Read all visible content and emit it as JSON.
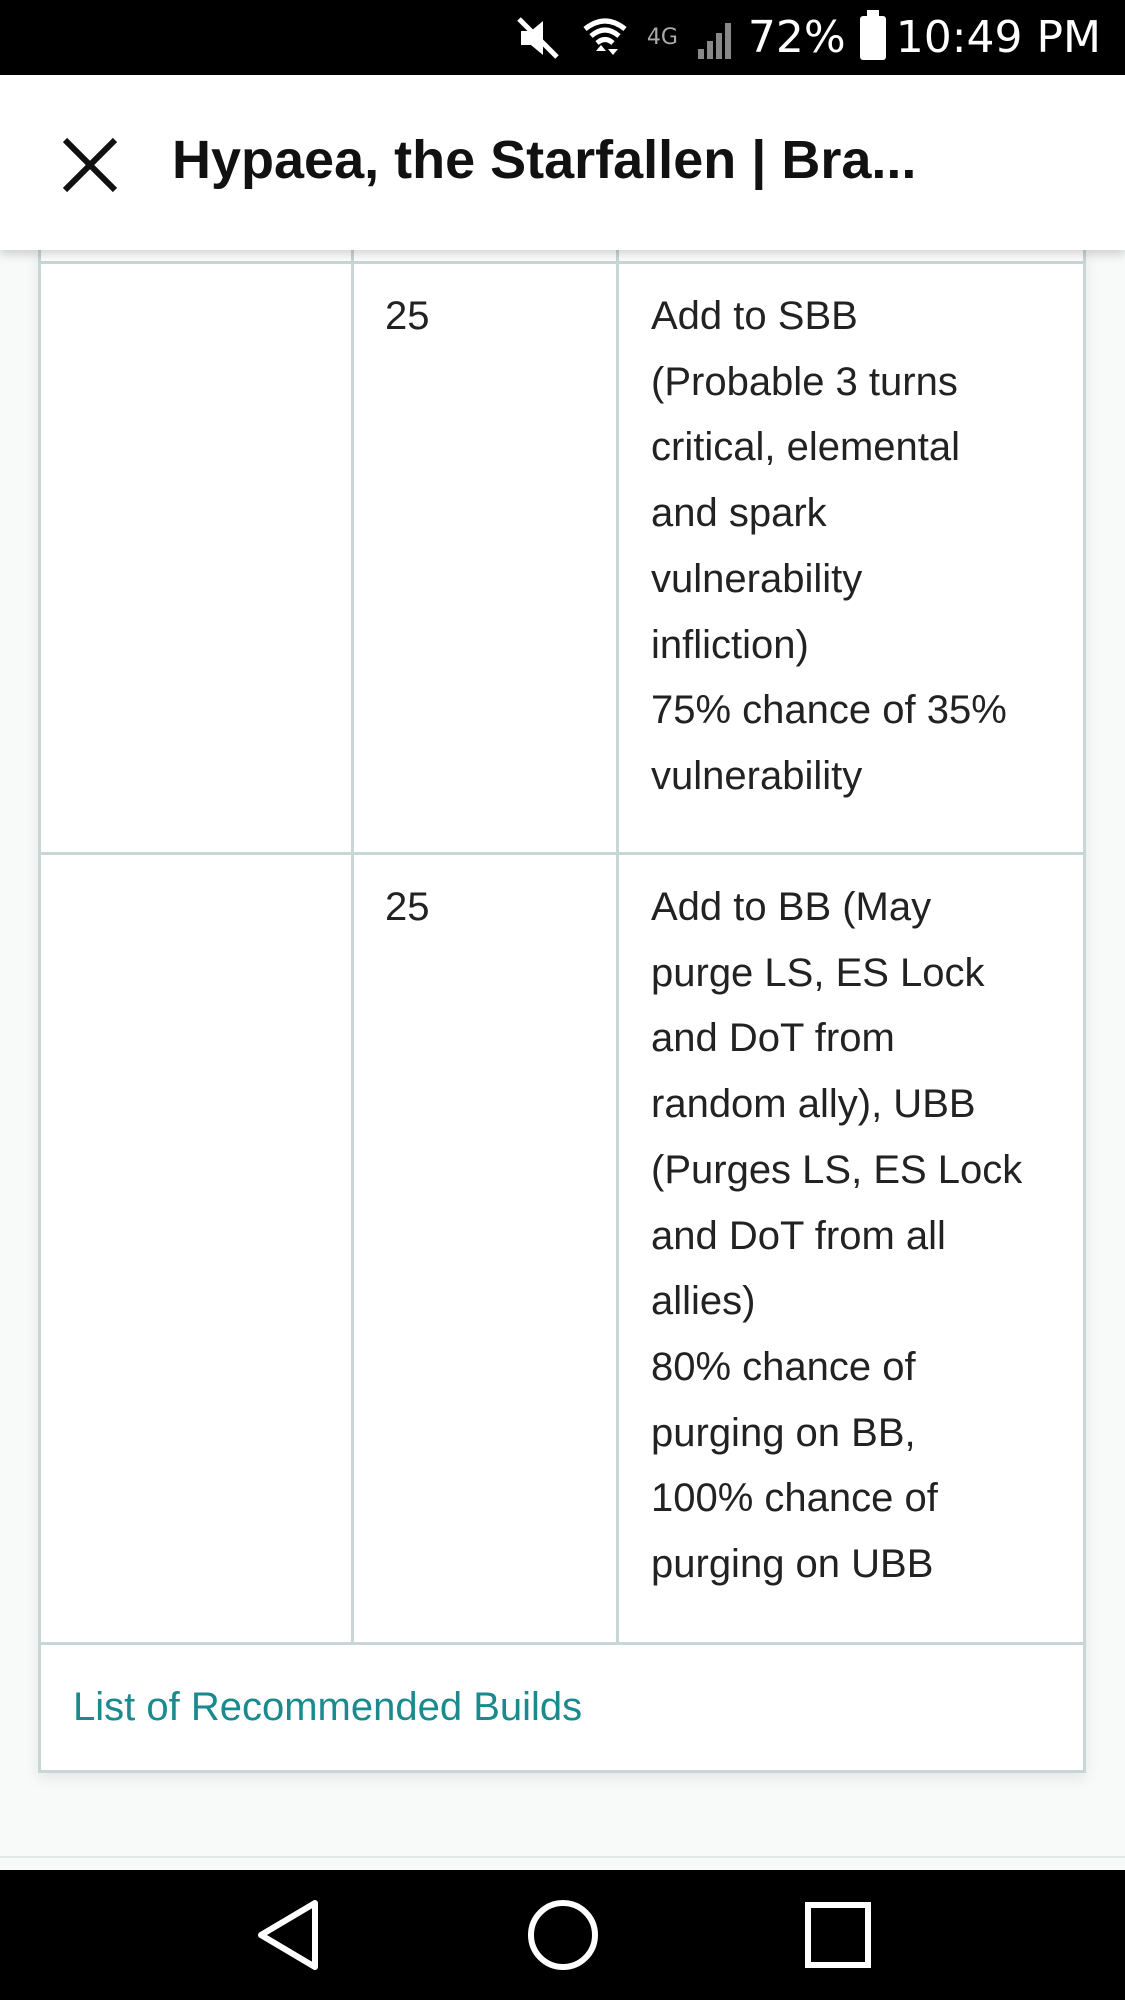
{
  "status_bar": {
    "network_label": "4G",
    "battery_percent": "72%",
    "time": "10:49 PM",
    "icons": [
      "mute-icon",
      "wifi-icon",
      "network-4g-icon",
      "signal-icon",
      "battery-icon"
    ]
  },
  "header": {
    "close_icon": "close-icon",
    "title": "Hypaea, the Starfallen | Bra..."
  },
  "table": {
    "rows": [
      {
        "col1": "",
        "col2": "25",
        "col3": "Add to SBB\n(Probable 3 turns\ncritical, elemental\nand spark\nvulnerability\ninfliction)\n75% chance of 35%\nvulnerability"
      },
      {
        "col1": "",
        "col2": "25",
        "col3": "Add to BB (May\npurge LS, ES Lock\nand DoT from\nrandom ally), UBB\n(Purges LS, ES Lock\nand DoT from all\nallies)\n80% chance of\npurging on BB,\n100% chance of\npurging on UBB"
      }
    ],
    "footer_link": "List of Recommended Builds"
  },
  "nav_bar": {
    "back_icon": "back-icon",
    "home_icon": "home-icon",
    "recents_icon": "recents-icon"
  },
  "colors": {
    "link": "#1a8a8e",
    "table_border": "#c9d6d6",
    "bars": "#000000"
  }
}
